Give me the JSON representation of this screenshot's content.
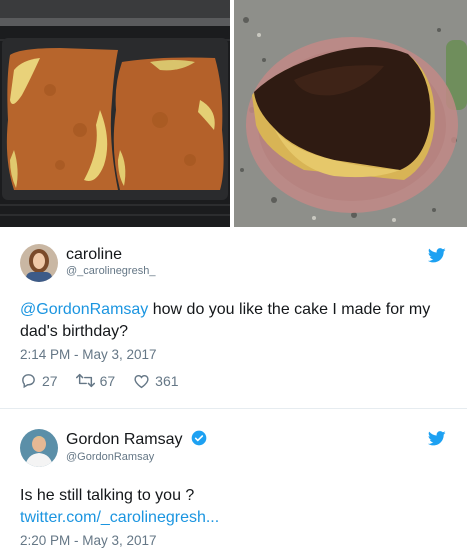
{
  "images": {
    "left_alt": "Cake in baking pan",
    "right_alt": "Chocolate frosted cake on glass plate"
  },
  "tweet1": {
    "author": "caroline",
    "handle": "@_carolinegresh_",
    "mention": "@GordonRamsay",
    "text_rest": " how do you like the cake I made for my dad's birthday?",
    "timestamp": "2:14 PM - May 3, 2017",
    "reply_count": "27",
    "retweet_count": "67",
    "like_count": "361"
  },
  "tweet2": {
    "author": "Gordon Ramsay",
    "handle": "@GordonRamsay",
    "text": "Is he still talking to you ?",
    "link": "twitter.com/_carolinegresh...",
    "timestamp": "2:20 PM - May 3, 2017"
  },
  "colors": {
    "twitter_blue": "#1da1f2",
    "link_blue": "#1b95e0",
    "muted": "#657786"
  },
  "icons": [
    "twitter-bird-icon",
    "reply-icon",
    "retweet-icon",
    "like-icon",
    "verified-badge-icon"
  ]
}
